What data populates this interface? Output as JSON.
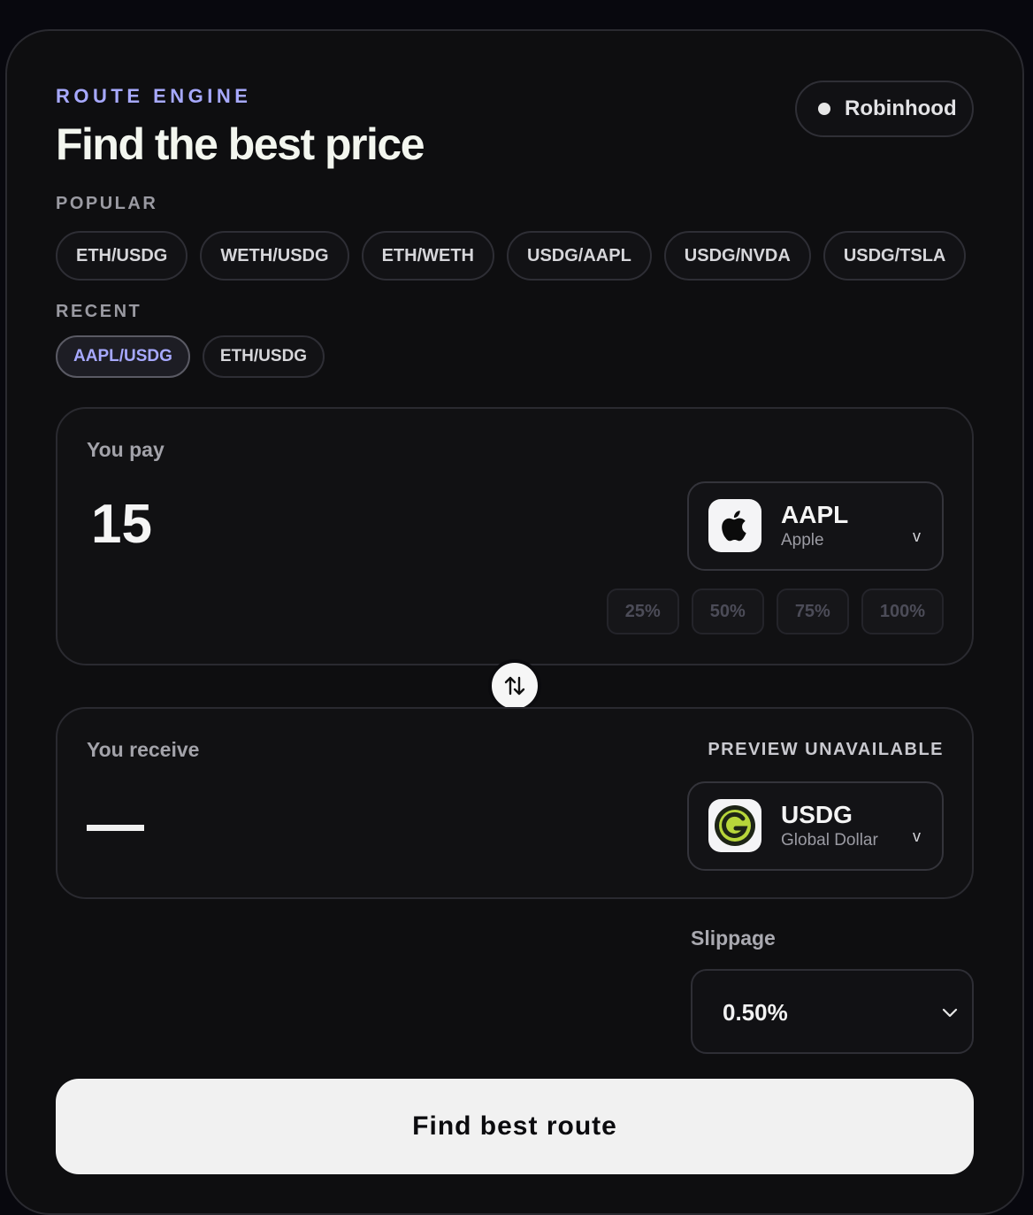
{
  "header": {
    "eyebrow": "ROUTE ENGINE",
    "title": "Find the best price",
    "network_label": "Robinhood"
  },
  "popular": {
    "label": "POPULAR",
    "pairs": [
      "ETH/USDG",
      "WETH/USDG",
      "ETH/WETH",
      "USDG/AAPL",
      "USDG/NVDA",
      "USDG/TSLA",
      ""
    ]
  },
  "recent": {
    "label": "RECENT",
    "pairs": [
      "AAPL/USDG",
      "ETH/USDG"
    ],
    "active_index": 0
  },
  "pay": {
    "label": "You pay",
    "amount": "15",
    "token_symbol": "AAPL",
    "token_name": "Apple",
    "token_icon": "apple-logo-icon",
    "chevron": "v",
    "percent_options": [
      "25%",
      "50%",
      "75%",
      "100%"
    ]
  },
  "swap": {
    "icon": "swap-arrows-icon"
  },
  "receive": {
    "label": "You receive",
    "status": "PREVIEW UNAVAILABLE",
    "token_symbol": "USDG",
    "token_name": "Global Dollar",
    "token_icon": "global-dollar-logo-icon",
    "chevron": "v"
  },
  "slippage": {
    "label": "Slippage",
    "value": "0.50%"
  },
  "cta": {
    "label": "Find best route"
  },
  "colors": {
    "accent": "#a7a9ff",
    "background": "#0e0e10",
    "usdg_green": "#b7d63a"
  }
}
